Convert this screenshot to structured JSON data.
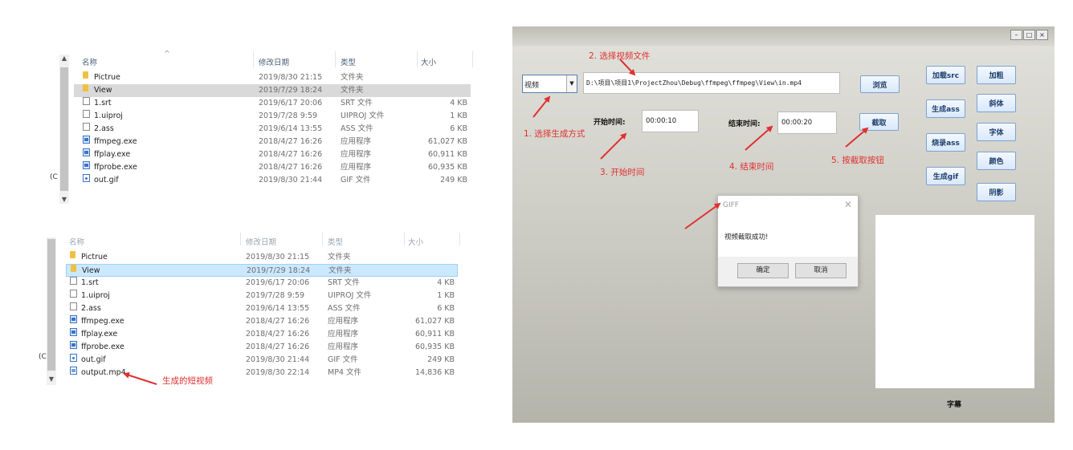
{
  "explorer": {
    "columns": [
      "名称",
      "修改日期",
      "类型",
      "大小"
    ],
    "left_stub": "(C",
    "top_files": [
      {
        "name": "Pictrue",
        "date": "2019/8/30 21:15",
        "type": "文件夹",
        "size": "",
        "icon": "folder"
      },
      {
        "name": "View",
        "date": "2019/7/29 18:24",
        "type": "文件夹",
        "size": "",
        "icon": "folder"
      },
      {
        "name": "1.srt",
        "date": "2019/6/17 20:06",
        "type": "SRT 文件",
        "size": "4 KB",
        "icon": "file"
      },
      {
        "name": "1.uiproj",
        "date": "2019/7/28 9:59",
        "type": "UIPROJ 文件",
        "size": "1 KB",
        "icon": "file"
      },
      {
        "name": "2.ass",
        "date": "2019/6/14 13:55",
        "type": "ASS 文件",
        "size": "6 KB",
        "icon": "file"
      },
      {
        "name": "ffmpeg.exe",
        "date": "2018/4/27 16:26",
        "type": "应用程序",
        "size": "61,027 KB",
        "icon": "exe"
      },
      {
        "name": "ffplay.exe",
        "date": "2018/4/27 16:26",
        "type": "应用程序",
        "size": "60,911 KB",
        "icon": "exe"
      },
      {
        "name": "ffprobe.exe",
        "date": "2018/4/27 16:26",
        "type": "应用程序",
        "size": "60,935 KB",
        "icon": "exe"
      },
      {
        "name": "out.gif",
        "date": "2019/8/30 21:44",
        "type": "GIF 文件",
        "size": "249 KB",
        "icon": "gif"
      }
    ],
    "bottom_files": [
      {
        "name": "Pictrue",
        "date": "2019/8/30 21:15",
        "type": "文件夹",
        "size": "",
        "icon": "folder"
      },
      {
        "name": "View",
        "date": "2019/7/29 18:24",
        "type": "文件夹",
        "size": "",
        "icon": "folder"
      },
      {
        "name": "1.srt",
        "date": "2019/6/17 20:06",
        "type": "SRT 文件",
        "size": "4 KB",
        "icon": "file"
      },
      {
        "name": "1.uiproj",
        "date": "2019/7/28 9:59",
        "type": "UIPROJ 文件",
        "size": "1 KB",
        "icon": "file"
      },
      {
        "name": "2.ass",
        "date": "2019/6/14 13:55",
        "type": "ASS 文件",
        "size": "6 KB",
        "icon": "file"
      },
      {
        "name": "ffmpeg.exe",
        "date": "2018/4/27 16:26",
        "type": "应用程序",
        "size": "61,027 KB",
        "icon": "exe"
      },
      {
        "name": "ffplay.exe",
        "date": "2018/4/27 16:26",
        "type": "应用程序",
        "size": "60,911 KB",
        "icon": "exe"
      },
      {
        "name": "ffprobe.exe",
        "date": "2018/4/27 16:26",
        "type": "应用程序",
        "size": "60,935 KB",
        "icon": "exe"
      },
      {
        "name": "out.gif",
        "date": "2019/8/30 21:44",
        "type": "GIF 文件",
        "size": "249 KB",
        "icon": "gif"
      },
      {
        "name": "output.mp4",
        "date": "2019/8/30 22:14",
        "type": "MP4 文件",
        "size": "14,836 KB",
        "icon": "mp4"
      }
    ]
  },
  "annotations": {
    "short_video": "生成的短视频",
    "step1": "1. 选择生成方式",
    "step2": "2. 选择视频文件",
    "step3": "3. 开始时间",
    "step4": "4. 结束时间",
    "step5": "5. 按截取按钮"
  },
  "app": {
    "mode_select": "视频",
    "file_path": "D:\\项目\\项目1\\ProjectZhou\\Debug\\ffmpeg\\ffmpeg\\View\\in.mp4",
    "browse_label": "浏览",
    "start_label": "开始时间:",
    "start_value": "00:00:10",
    "end_label": "结束时间:",
    "end_value": "00:00:20",
    "cut_label": "截取",
    "buttons_col1": [
      "加载src",
      "生成ass",
      "烧录ass",
      "生成gif"
    ],
    "buttons_col2": [
      "加粗",
      "斜体",
      "字体",
      "颜色",
      "阴影"
    ],
    "subtitle_label": "字幕",
    "window_buttons": [
      "–",
      "□",
      "×"
    ]
  },
  "dialog": {
    "title": "GIFF",
    "message": "视频截取成功!",
    "ok": "确定",
    "cancel": "取消"
  },
  "colors": {
    "annotation_red": "#e03030",
    "selected_row": "#d9d9d9",
    "selected_row_blue": "#cce8ff"
  }
}
